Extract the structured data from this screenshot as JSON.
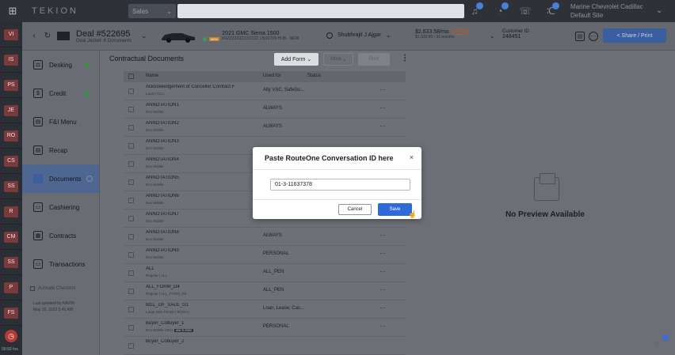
{
  "app": {
    "logo": "TEKION",
    "sales_select": "Sales",
    "dealer_name": "Marine Chevrolet Cadillac",
    "dealer_site": "Default Site"
  },
  "rail": {
    "items": [
      "VI",
      "IS",
      "PS",
      "JE",
      "RO",
      "CS",
      "SS",
      "R",
      "CM",
      "SS",
      "P",
      "FS"
    ],
    "time": "00:50 hrs"
  },
  "deal": {
    "title": "Deal #522695",
    "subtitle": "Deal Jacket: 8 Documents",
    "vehicle_title": "2021 GMC Sierra 1500",
    "vehicle_sub": "#GZZZZZZZZZZZZZ | BUILTIN HUB · NEW",
    "vehicle_tag": "NEW",
    "agent": "Shubhrajit J Ajgar",
    "payment": "$2,633.58/mo",
    "payment_badge": "Loan",
    "payment_sub": "$1,333.80 / 36 months",
    "customer_label": "Customer ID",
    "customer_id": "248451",
    "share_label": "< Share / Print"
  },
  "leftnav": {
    "items": [
      {
        "label": "Desking"
      },
      {
        "label": "Credit"
      },
      {
        "label": "F&I Menu"
      },
      {
        "label": "Recap"
      },
      {
        "label": "Documents"
      },
      {
        "label": "Cashiering"
      },
      {
        "label": "Contracts"
      },
      {
        "label": "Transactions"
      }
    ],
    "activate_label": "Activate Checklist",
    "updated_line1": "Last updated by RAYIR",
    "updated_line2": "May 10, 2023 5:41 AM"
  },
  "documents": {
    "title": "Contractual Documents",
    "add_form": "Add Form",
    "store": "Store",
    "print": "Print",
    "col_name": "Name",
    "col_used_for": "Used for",
    "col_status": "Status",
    "rows": [
      {
        "name": "Acknowledgement of Conceller Contract F",
        "sub": "Local | ACC",
        "used": "Ally VSC, SafeGu...",
        "chip": ""
      },
      {
        "name": "ANNOTATION1",
        "sub": "Doc Mobile",
        "used": "ALWAYS",
        "chip": ""
      },
      {
        "name": "ANNOTATION2",
        "sub": "Doc Mobile",
        "used": "ALWAYS",
        "chip": ""
      },
      {
        "name": "ANNOTATION3",
        "sub": "Doc Mobile",
        "used": "",
        "chip": ""
      },
      {
        "name": "ANNOTATION4",
        "sub": "Doc Mobile",
        "used": "",
        "chip": ""
      },
      {
        "name": "ANNOTATION5",
        "sub": "Doc Mobile",
        "used": "",
        "chip": ""
      },
      {
        "name": "ANNOTATION6",
        "sub": "Doc Mobile",
        "used": "",
        "chip": ""
      },
      {
        "name": "ANNOTATION7",
        "sub": "Doc Mobile",
        "used": "ALWAYS",
        "chip": ""
      },
      {
        "name": "ANNOTATION8",
        "sub": "Doc Mobile",
        "used": "ALWAYS",
        "chip": ""
      },
      {
        "name": "ANNOTATION9",
        "sub": "Doc Mobile",
        "used": "PERSONAL",
        "chip": ""
      },
      {
        "name": "ALL",
        "sub": "Regular | ALL",
        "used": "ALL_PEN",
        "chip": ""
      },
      {
        "name": "ALL_FORM_D4",
        "sub": "Regular | ALL_FORM_D4",
        "used": "ALL_PEN",
        "chip": ""
      },
      {
        "name": "BILL_OF_SALE_G1",
        "sub": "Large Size Printer | BOSG1",
        "used": "Loan, Lease, Cas...",
        "chip": ""
      },
      {
        "name": "Buyer_Cobuyer_1",
        "sub": "Doc Mobile | RCI",
        "used": "PERSONAL",
        "chip": "MULTI-SIGN"
      },
      {
        "name": "Buyer_Cobuyer_2",
        "sub": "",
        "used": "",
        "chip": ""
      }
    ]
  },
  "preview": {
    "message": "No Preview Available"
  },
  "modal": {
    "title": "Paste RouteOne Conversation ID here",
    "close": "×",
    "input_value": "01-3-11637378",
    "cancel": "Cancel",
    "save": "Save"
  }
}
